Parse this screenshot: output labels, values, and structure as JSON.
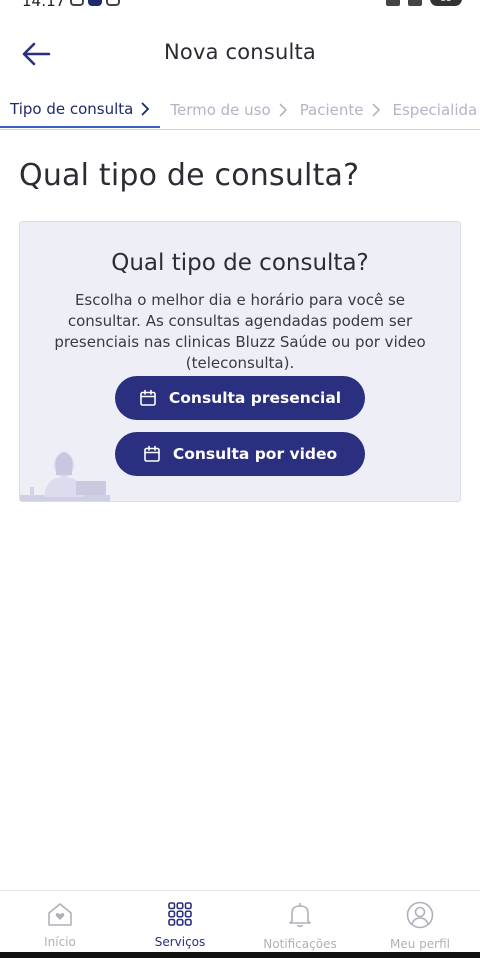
{
  "status": {
    "time": "14:17",
    "battery": "83"
  },
  "header": {
    "title": "Nova consulta",
    "back_icon": "arrow-left-icon"
  },
  "stepper": {
    "steps": [
      {
        "label": "Tipo de consulta",
        "active": true
      },
      {
        "label": "Termo de uso",
        "active": false
      },
      {
        "label": "Paciente",
        "active": false
      },
      {
        "label": "Especialida",
        "active": false
      }
    ]
  },
  "page": {
    "title": "Qual tipo de consulta?"
  },
  "card": {
    "title": "Qual tipo de consulta?",
    "description": "Escolha o melhor dia e horário para você se consultar. As consultas agendadas podem ser presenciais nas clinicas Bluzz Saúde ou por video (teleconsulta).",
    "buttons": [
      {
        "label": "Consulta presencial",
        "icon": "calendar-icon"
      },
      {
        "label": "Consulta por video",
        "icon": "calendar-icon"
      }
    ]
  },
  "nav": {
    "items": [
      {
        "label": "Início",
        "icon": "home-heart-icon",
        "active": false
      },
      {
        "label": "Serviços",
        "icon": "grid-icon",
        "active": true
      },
      {
        "label": "Notificações",
        "icon": "bell-icon",
        "active": false
      },
      {
        "label": "Meu perfil",
        "icon": "user-icon",
        "active": false
      }
    ]
  },
  "colors": {
    "primary": "#2b2f7f",
    "accent_line": "#3b60c4",
    "card_bg": "#eeeef6",
    "muted": "#b0b0bc"
  }
}
